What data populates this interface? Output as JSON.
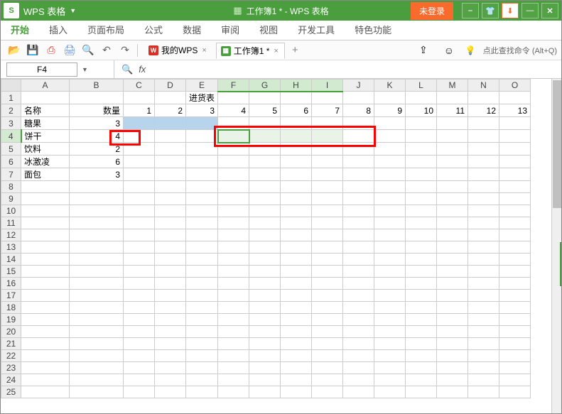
{
  "titlebar": {
    "logo": "S",
    "app_name": "WPS 表格",
    "file_title": "工作簿1 * - WPS 表格",
    "login_label": "未登录"
  },
  "menubar": {
    "items": [
      {
        "label": "开始",
        "active": true
      },
      {
        "label": "插入"
      },
      {
        "label": "页面布局"
      },
      {
        "label": "公式"
      },
      {
        "label": "数据"
      },
      {
        "label": "审阅"
      },
      {
        "label": "视图"
      },
      {
        "label": "开发工具"
      },
      {
        "label": "特色功能"
      }
    ]
  },
  "toolbar": {
    "tabs": [
      {
        "label": "我的WPS",
        "kind": "wps"
      },
      {
        "label": "工作簿1 *",
        "kind": "xls",
        "active": true
      }
    ],
    "help_text": "点此查找命令 (Alt+Q)"
  },
  "formulabar": {
    "name_box": "F4",
    "fx_label": "fx"
  },
  "grid": {
    "columns": [
      "A",
      "B",
      "C",
      "D",
      "E",
      "F",
      "G",
      "H",
      "I",
      "J",
      "K",
      "L",
      "M",
      "N",
      "O"
    ],
    "visible_rows": 25,
    "selected_columns": [
      "F",
      "G",
      "H",
      "I"
    ],
    "active_row": 4,
    "merged_title": {
      "row": 1,
      "text": "进货表"
    },
    "data": {
      "r2": {
        "A": "名称",
        "B": "数量",
        "C": "1",
        "D": "2",
        "E": "3",
        "F": "4",
        "G": "5",
        "H": "6",
        "I": "7",
        "J": "8",
        "K": "9",
        "L": "10",
        "M": "11",
        "N": "12",
        "O": "13"
      },
      "r3": {
        "A": "糖果",
        "B": "3"
      },
      "r4": {
        "A": "饼干",
        "B": "4"
      },
      "r5": {
        "A": "饮料",
        "B": "2"
      },
      "r6": {
        "A": "冰激凌",
        "B": "6"
      },
      "r7": {
        "A": "面包",
        "B": "3"
      }
    },
    "fill_region": {
      "row": 3,
      "from_col": "C",
      "to_col": "E"
    },
    "selection_region": {
      "row": 4,
      "from_col": "F",
      "to_col": "I"
    }
  }
}
